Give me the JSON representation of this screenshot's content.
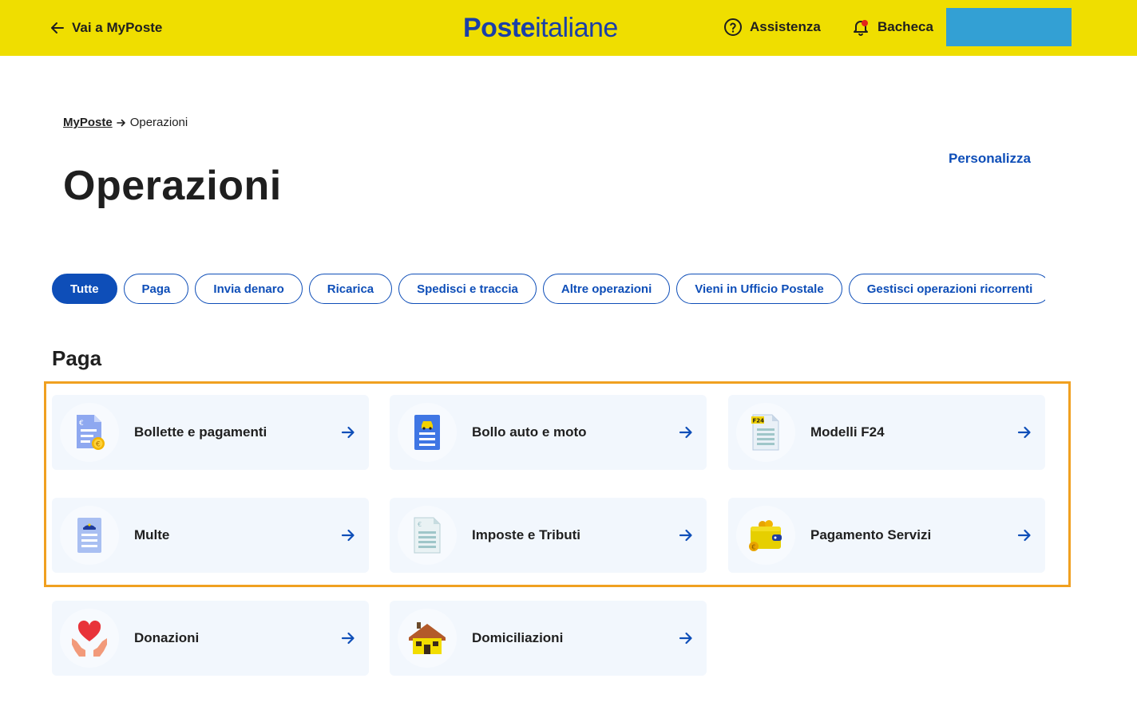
{
  "header": {
    "back_label": "Vai a MyPoste",
    "logo_bold": "Poste",
    "logo_light": "italiane",
    "assistenza_label": "Assistenza",
    "bacheca_label": "Bacheca",
    "brand_color": "#efde00",
    "user_box_color": "#33a0d4"
  },
  "breadcrumb": {
    "root": "MyPoste",
    "current": "Operazioni"
  },
  "page": {
    "title": "Operazioni",
    "personalizza_label": "Personalizza",
    "accent_color": "#0e4eb8"
  },
  "filters": {
    "active": "Tutte",
    "items": [
      "Tutte",
      "Paga",
      "Invia denaro",
      "Ricarica",
      "Spedisci e traccia",
      "Altre operazioni",
      "Vieni in Ufficio Postale",
      "Gestisci operazioni ricorrenti"
    ]
  },
  "section": {
    "title": "Paga",
    "highlight_color": "#f0a020",
    "cards": [
      {
        "label": "Bollette e pagamenti",
        "icon": "bill-euro-icon"
      },
      {
        "label": "Bollo auto e moto",
        "icon": "car-document-icon"
      },
      {
        "label": "Modelli F24",
        "icon": "f24-document-icon"
      },
      {
        "label": "Multe",
        "icon": "police-fine-icon"
      },
      {
        "label": "Imposte e Tributi",
        "icon": "tax-document-icon"
      },
      {
        "label": "Pagamento Servizi",
        "icon": "wallet-icon"
      },
      {
        "label": "Donazioni",
        "icon": "heart-hands-icon"
      },
      {
        "label": "Domiciliazioni",
        "icon": "house-icon"
      }
    ]
  }
}
